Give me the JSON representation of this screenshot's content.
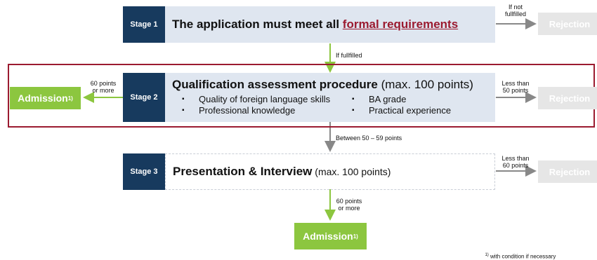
{
  "stage1": {
    "label": "Stage 1",
    "title_prefix": "The application must meet all ",
    "title_link": "formal requirements",
    "note_not_fulfilled_1": "If not",
    "note_not_fulfilled_2": "fullfilled",
    "rejection": "Rejection",
    "note_fulfilled": "If fullfilled"
  },
  "stage2": {
    "label": "Stage 2",
    "title": "Qualification assessment procedure",
    "title_suffix": " (max. 100 points)",
    "bullets_left": [
      "Quality of foreign language skills",
      "Professional knowledge"
    ],
    "bullets_right": [
      "BA grade",
      "Practical experience"
    ],
    "bullet_char": "▪",
    "left_note_1": "60 points",
    "left_note_2": "or more",
    "admission": "Admission",
    "footnote_mark": "1)",
    "right_note_1": "Less than",
    "right_note_2": "50 points",
    "rejection": "Rejection",
    "down_note": "Between 50 – 59 points"
  },
  "stage3": {
    "label": "Stage 3",
    "title": "Presentation & Interview",
    "title_suffix": " (max. 100 points)",
    "right_note_1": "Less than",
    "right_note_2": "60 points",
    "rejection": "Rejection",
    "down_note_1": "60 points",
    "down_note_2": "or more",
    "admission": "Admission",
    "footnote_mark": "1)"
  },
  "footnote": {
    "mark": "1)",
    "text": " with condition if necessary"
  },
  "colors": {
    "stage_label": "#173a5e",
    "stage_box": "#dfe6f0",
    "admission": "#8cc63f",
    "rejection": "#e6e6e6",
    "highlight_border": "#9b1b30",
    "link": "#9b1b30",
    "arrow_gray": "#888888"
  }
}
